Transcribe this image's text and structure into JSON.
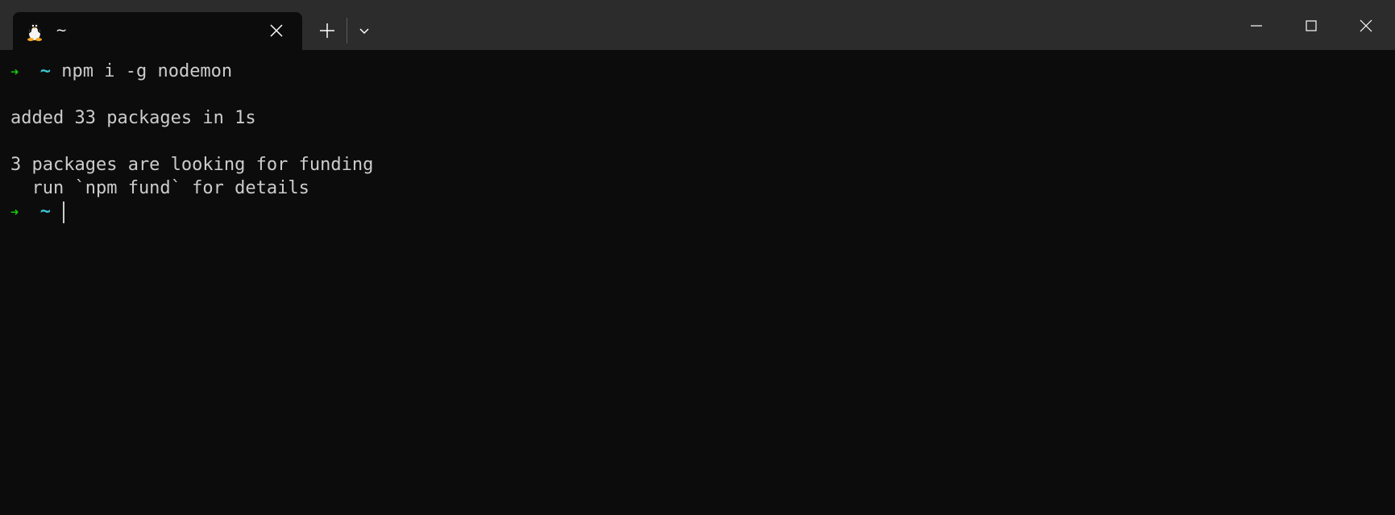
{
  "tab": {
    "title": "~",
    "icon": "linux-tux-icon"
  },
  "titlebar": {
    "new_tab_icon": "plus-icon",
    "dropdown_icon": "chevron-down-icon",
    "minimize_icon": "minimize-icon",
    "maximize_icon": "maximize-icon",
    "close_icon": "close-icon"
  },
  "terminal": {
    "prompt_arrow": "➜",
    "prompt_dir": "~",
    "lines": [
      {
        "type": "prompt",
        "command": "npm i -g nodemon"
      },
      {
        "type": "output",
        "text": ""
      },
      {
        "type": "output",
        "text": "added 33 packages in 1s"
      },
      {
        "type": "output",
        "text": ""
      },
      {
        "type": "output",
        "text": "3 packages are looking for funding"
      },
      {
        "type": "output",
        "text": "  run `npm fund` for details"
      },
      {
        "type": "prompt",
        "command": ""
      }
    ]
  },
  "colors": {
    "background": "#0c0c0c",
    "titlebar": "#2c2c2c",
    "prompt_arrow": "#16c60c",
    "prompt_dir": "#3bc6d6",
    "text": "#cccccc"
  }
}
